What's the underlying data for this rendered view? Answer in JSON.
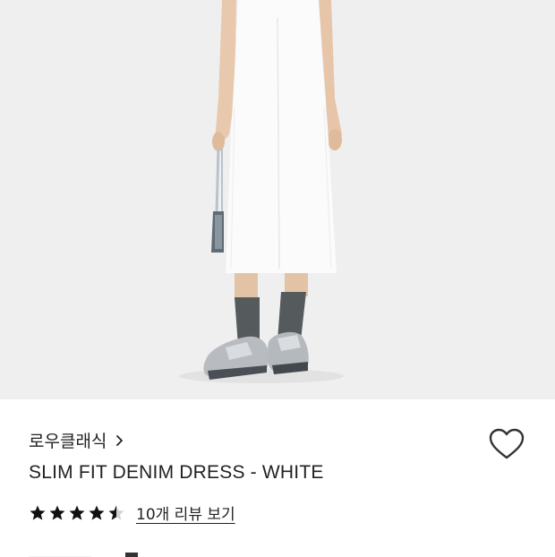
{
  "product": {
    "image_icon": "product-photo-model-white-dress",
    "brand": "로우클래식",
    "brand_chevron_icon": "chevron-right-icon",
    "title": "SLIM FIT DENIM DRESS - WHITE",
    "wishlist_icon": "heart-outline-icon",
    "rating": 4.5,
    "review_link": "10개 리뷰 보기"
  },
  "colors": {
    "background": "#ffffff",
    "photo_background": "#efefef",
    "text": "#222222",
    "star": "#111111"
  }
}
